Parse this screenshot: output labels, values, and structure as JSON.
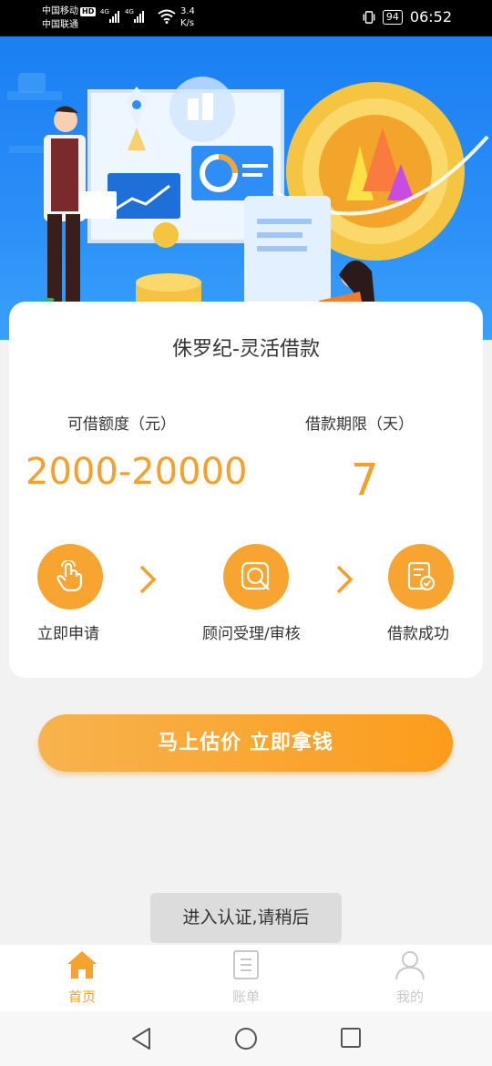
{
  "status_bar": {
    "carrier1": "中国移动",
    "hd": "HD",
    "carrier2": "中国联通",
    "net1": "4G",
    "net2": "4G",
    "speed_value": "3.4",
    "speed_unit": "K/s",
    "battery": "94",
    "time": "06:52"
  },
  "card": {
    "title": "侏罗纪-灵活借款",
    "amount_label": "可借额度（元）",
    "amount_value": "2000-20000",
    "term_label": "借款期限（天）",
    "term_value": "7",
    "steps": [
      {
        "label": "立即申请",
        "icon": "hand-tap-icon"
      },
      {
        "label": "顾问受理/审核",
        "icon": "magnifier-icon"
      },
      {
        "label": "借款成功",
        "icon": "document-check-icon"
      }
    ]
  },
  "cta": {
    "label": "马上估价  立即拿钱"
  },
  "toast": {
    "text": "进入认证,请稍后"
  },
  "tabbar": {
    "items": [
      {
        "label": "首页",
        "icon": "home-icon",
        "active": true
      },
      {
        "label": "账单",
        "icon": "bill-icon",
        "active": false
      },
      {
        "label": "我的",
        "icon": "user-icon",
        "active": false
      }
    ]
  },
  "colors": {
    "accent": "#f6a02c",
    "banner_blue": "#1a7ff2",
    "tab_inactive": "#c8c8c8"
  }
}
